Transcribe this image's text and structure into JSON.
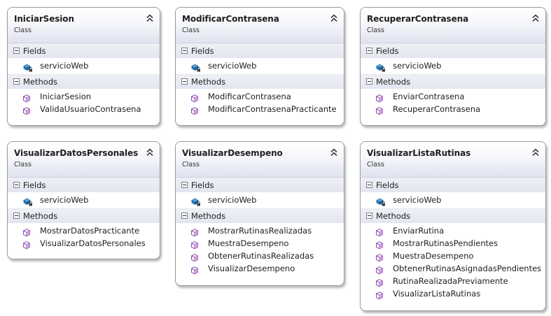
{
  "labels": {
    "stereotype": "Class",
    "fields": "Fields",
    "methods": "Methods"
  },
  "classes": [
    {
      "name": "IniciarSesion",
      "fields": [
        "servicioWeb"
      ],
      "methods": [
        "IniciarSesion",
        "ValidaUsuarioContrasena"
      ]
    },
    {
      "name": "ModificarContrasena",
      "fields": [
        "servicioWeb"
      ],
      "methods": [
        "ModificarContrasena",
        "ModificarContrasenaPracticante"
      ]
    },
    {
      "name": "RecuperarContrasena",
      "fields": [
        "servicioWeb"
      ],
      "methods": [
        "EnviarContrasena",
        "RecuperarContrasena"
      ]
    },
    {
      "name": "VisualizarDatosPersonales",
      "fields": [
        "servicioWeb"
      ],
      "methods": [
        "MostrarDatosPracticante",
        "VisualizarDatosPersonales"
      ]
    },
    {
      "name": "VisualizarDesempeno",
      "fields": [
        "servicioWeb"
      ],
      "methods": [
        "MostrarRutinasRealizadas",
        "MuestraDesempeno",
        "ObtenerRutinasRealizadas",
        "VisualizarDesempeno"
      ]
    },
    {
      "name": "VisualizarListaRutinas",
      "fields": [
        "servicioWeb"
      ],
      "methods": [
        "EnviarRutina",
        "MostrarRutinasPendientes",
        "MuestraDesempeno",
        "ObtenerRutinasAsignadasPendientes",
        "RutinaRealizadaPreviamente",
        "VisualizarListaRutinas"
      ]
    }
  ],
  "icons": {
    "collapse": "double-chevron-up-icon",
    "section_toggle": "minus-box-icon",
    "field": "private-field-icon",
    "method": "method-cube-icon"
  },
  "colors": {
    "method_icon": "#8d44b0",
    "field_icon": "#2a7fbf",
    "header_gradient_bottom": "#dfe3ef",
    "section_band": "#e6e9f1"
  }
}
